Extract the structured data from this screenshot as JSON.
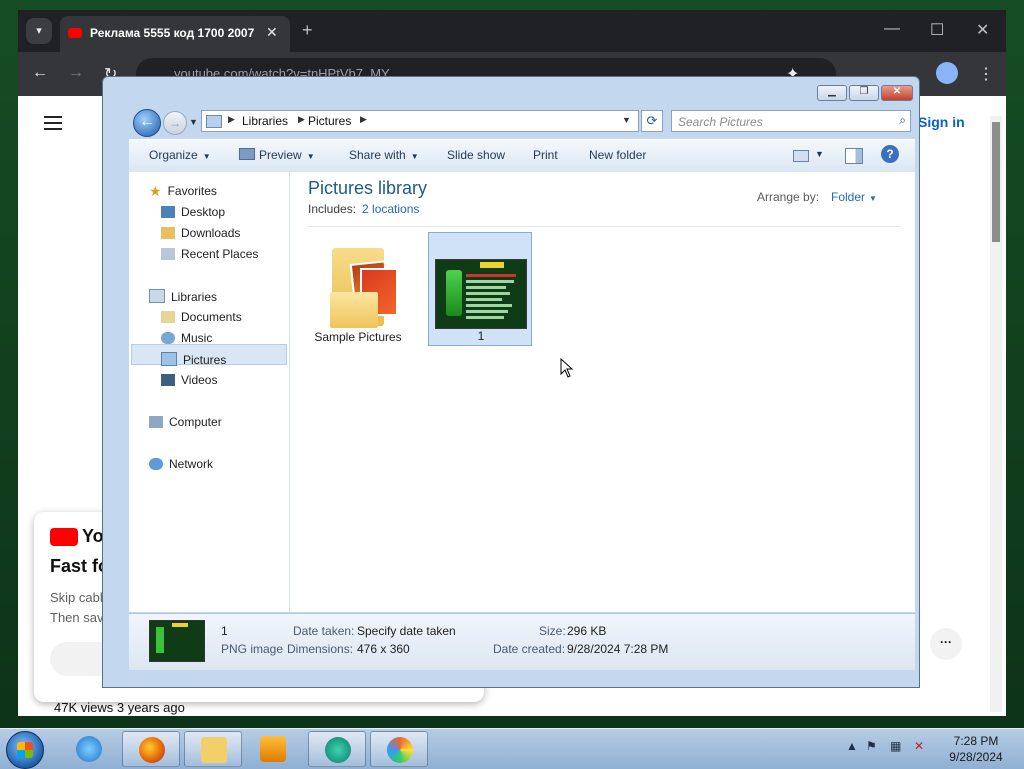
{
  "browser": {
    "tab_title": "Реклама 5555 код 1700 2007",
    "tab_close": "✕",
    "new_tab": "+",
    "url": "youtube.com/watch?v=tnHPtVb7_MY",
    "icons": [
      "back-icon",
      "forward-icon",
      "reload-icon",
      "extensions-icon",
      "profile-icon",
      "menu-icon"
    ]
  },
  "youtube": {
    "sign_in": "Sign in",
    "card": {
      "logo_text": "YouTube",
      "headline": "Fast forward to better TV",
      "line1": "Skip cable setup and repair service calls.",
      "line2": "Then save with YouTube TV."
    },
    "views": "47K views  3 years ago"
  },
  "explorer": {
    "breadcrumb": [
      "Libraries",
      "Pictures"
    ],
    "search_placeholder": "Search Pictures",
    "toolbar": {
      "organize": "Organize",
      "preview": "Preview",
      "share_with": "Share with",
      "slide_show": "Slide show",
      "print": "Print",
      "new_folder": "New folder"
    },
    "nav": {
      "favorites": "Favorites",
      "desktop": "Desktop",
      "downloads": "Downloads",
      "recent_places": "Recent Places",
      "libraries": "Libraries",
      "documents": "Documents",
      "music": "Music",
      "pictures": "Pictures",
      "videos": "Videos",
      "computer": "Computer",
      "network": "Network"
    },
    "library": {
      "title": "Pictures library",
      "includes_label": "Includes:",
      "locations": "2 locations",
      "arrange_label": "Arrange by:",
      "arrange_value": "Folder"
    },
    "items": [
      {
        "name": "Sample Pictures",
        "type": "folder"
      },
      {
        "name": "1",
        "type": "png-image",
        "selected": true
      }
    ],
    "details": {
      "name": "1",
      "type": "PNG image",
      "date_taken_label": "Date taken:",
      "date_taken_value": "Specify date taken",
      "dimensions_label": "Dimensions:",
      "dimensions_value": "476 x 360",
      "size_label": "Size:",
      "size_value": "296 KB",
      "date_created_label": "Date created:",
      "date_created_value": "9/28/2024 7:28 PM"
    }
  },
  "taskbar": {
    "time": "7:28 PM",
    "date": "9/28/2024",
    "apps": [
      "internet-explorer",
      "firefox",
      "file-explorer",
      "media-player",
      "app-green",
      "paint"
    ]
  }
}
